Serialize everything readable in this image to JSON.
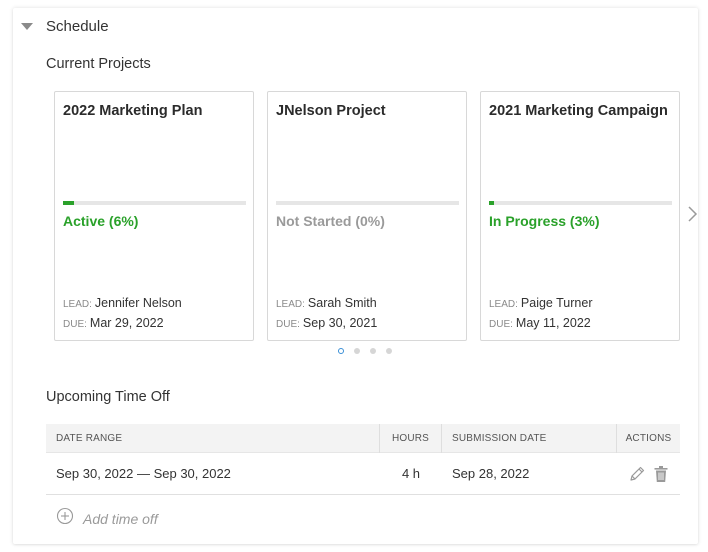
{
  "section": {
    "title": "Schedule"
  },
  "current_projects": {
    "title": "Current Projects",
    "lead_key": "LEAD:",
    "due_key": "DUE:",
    "cards": [
      {
        "name": "2022 Marketing Plan",
        "status": "Active (6%)",
        "progress": 0.06,
        "status_color": "#2aa12a",
        "lead": "Jennifer Nelson",
        "due": "Mar 29, 2022"
      },
      {
        "name": "JNelson Project",
        "status": "Not Started (0%)",
        "progress": 0.0,
        "status_color": "#9a9a9a",
        "lead": "Sarah Smith",
        "due": "Sep 30, 2021"
      },
      {
        "name": "2021 Marketing Campaign",
        "status": "In Progress (3%)",
        "progress": 0.03,
        "status_color": "#2aa12a",
        "lead": "Paige Turner",
        "due": "May 11, 2022"
      }
    ],
    "page_count": 4,
    "active_page": 1
  },
  "time_off": {
    "title": "Upcoming Time Off",
    "columns": {
      "date_range": "DATE RANGE",
      "hours": "HOURS",
      "submission_date": "SUBMISSION DATE",
      "actions": "ACTIONS"
    },
    "rows": [
      {
        "date_range": "Sep 30, 2022 — Sep 30, 2022",
        "hours": "4 h",
        "submission_date": "Sep 28, 2022"
      }
    ],
    "add_label": "Add time off"
  },
  "colors": {
    "accent_green": "#2aa12a",
    "muted_gray": "#9a9a9a",
    "dot_active": "#3a8fd6"
  },
  "icons": {
    "collapse": "caret-down-icon",
    "next": "chevron-right-icon",
    "edit": "pencil-icon",
    "delete": "trash-icon",
    "add": "plus-circle-icon"
  }
}
